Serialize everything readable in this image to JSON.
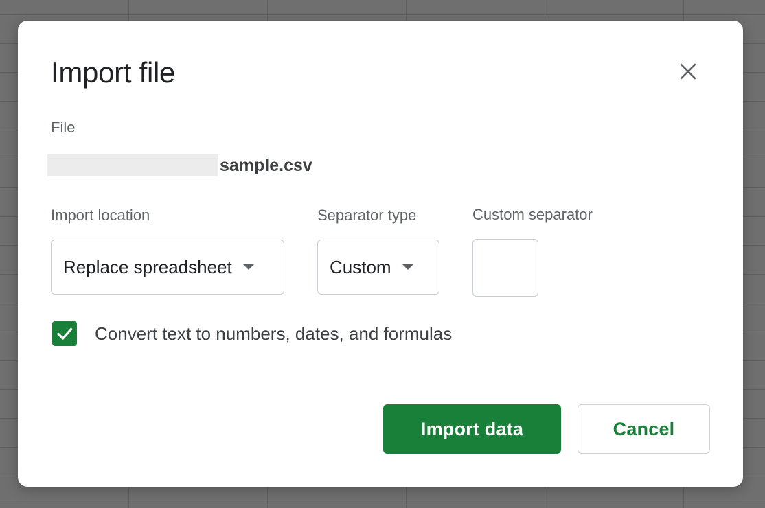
{
  "dialog": {
    "title": "Import file",
    "close_icon": "close-icon"
  },
  "file": {
    "label": "File",
    "name": "sample.csv",
    "name_prefix": ""
  },
  "import_location": {
    "label": "Import location",
    "selected": "Replace spreadsheet"
  },
  "separator_type": {
    "label": "Separator type",
    "selected": "Custom"
  },
  "custom_separator": {
    "label": "Custom separator",
    "value": ""
  },
  "convert_option": {
    "label": "Convert text to numbers, dates, and formulas",
    "checked": true
  },
  "actions": {
    "primary_label": "Import data",
    "secondary_label": "Cancel"
  },
  "colors": {
    "accent": "#188038",
    "title_text": "#202124",
    "label_text": "#5f6368",
    "backdrop": "#6f6f6f"
  }
}
